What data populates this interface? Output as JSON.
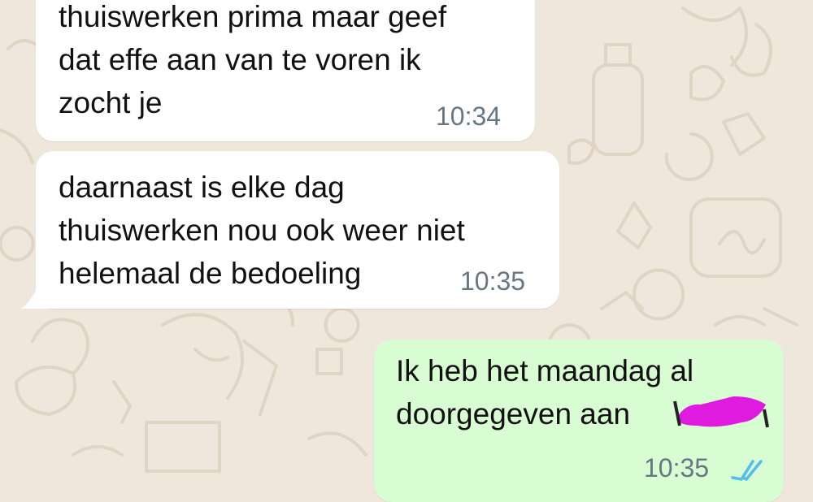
{
  "messages": [
    {
      "direction": "incoming",
      "text": "thuiswerken prima maar geef\ndat effe aan van te voren ik\nzocht je",
      "time": "10:34"
    },
    {
      "direction": "incoming",
      "text": "daarnaast is elke dag\nthuiswerken nou ook weer niet\nhelemaal de bedoeling",
      "time": "10:35"
    },
    {
      "direction": "outgoing",
      "text": "Ik heb het maandag al\ndoorgegeven aan",
      "time": "10:35",
      "status_icon": "double-check-read-icon",
      "redaction_color": "#e01be0"
    }
  ],
  "colors": {
    "wallpaper": "#efe7dc",
    "incoming_bubble": "#ffffff",
    "outgoing_bubble": "#d9fdd3",
    "read_ticks": "#53bdeb",
    "timestamp": "#667781"
  }
}
